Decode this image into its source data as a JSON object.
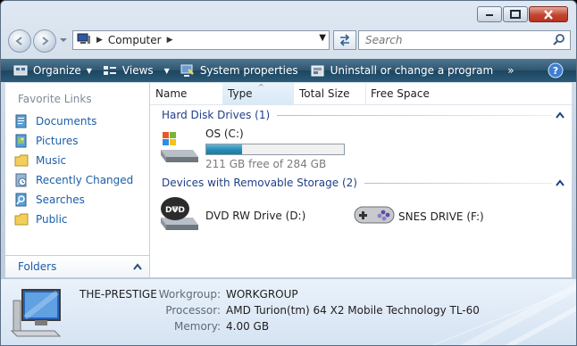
{
  "window": {
    "caption": {
      "minimize": "minimize",
      "maximize": "maximize",
      "close": "close"
    }
  },
  "address": {
    "crumb": "Computer",
    "search_placeholder": "Search"
  },
  "toolbar": {
    "organize": "Organize",
    "views": "Views",
    "system_properties": "System properties",
    "uninstall": "Uninstall or change a program",
    "more": "»"
  },
  "navpane": {
    "title": "Favorite Links",
    "items": [
      {
        "label": "Documents",
        "icon": "documents-icon"
      },
      {
        "label": "Pictures",
        "icon": "pictures-icon"
      },
      {
        "label": "Music",
        "icon": "music-folder-icon"
      },
      {
        "label": "Recently Changed",
        "icon": "recently-changed-icon"
      },
      {
        "label": "Searches",
        "icon": "searches-icon"
      },
      {
        "label": "Public",
        "icon": "public-folder-icon"
      }
    ],
    "folders": "Folders"
  },
  "columns": [
    "Name",
    "Type",
    "Total Size",
    "Free Space"
  ],
  "groups": {
    "hdd": "Hard Disk Drives (1)",
    "removable": "Devices with Removable Storage (2)"
  },
  "drives": {
    "c": {
      "name": "OS (C:)",
      "free_text": "211 GB free of 284 GB",
      "used_fraction": 0.257
    },
    "d": {
      "name": "DVD RW Drive (D:)"
    },
    "f": {
      "name": "SNES DRIVE (F:)"
    }
  },
  "details": {
    "hostname": "THE-PRESTIGE",
    "workgroup_label": "Workgroup:",
    "workgroup": "WORKGROUP",
    "processor_label": "Processor:",
    "processor": "AMD Turion(tm) 64 X2 Mobile Technology TL-60",
    "memory_label": "Memory:",
    "memory": "4.00 GB"
  },
  "colors": {
    "toolbar": "#2e5670",
    "link": "#1b5ea8",
    "group": "#1f3f87",
    "bar_fill": "#2a8fb7"
  }
}
